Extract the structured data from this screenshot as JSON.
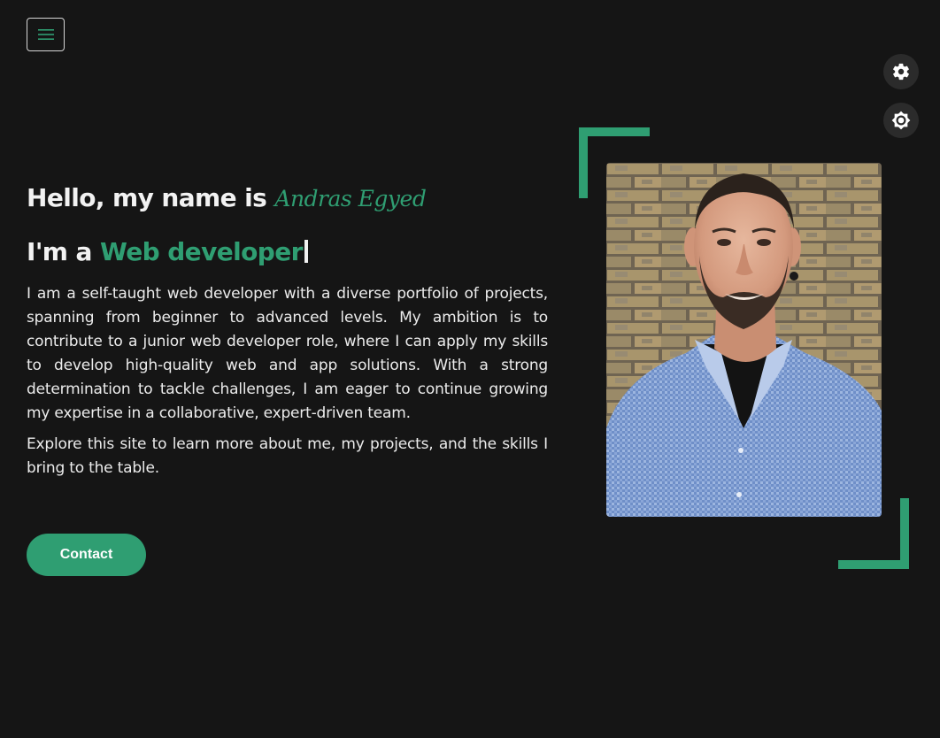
{
  "nav": {
    "menu_icon": "hamburger-icon",
    "settings_icon": "gear-icon",
    "theme_icon": "sun-icon"
  },
  "hero": {
    "greeting_prefix": "Hello, my name is",
    "name": "Andras Egyed",
    "role_prefix": "I'm a",
    "role": "Web developer",
    "about": "I am a self-taught web developer with a diverse portfolio of projects, spanning from beginner to advanced levels. My ambition is to contribute to a junior web developer role, where I can apply my skills to develop high-quality web and app solutions. With a strong determination to tackle challenges, I am eager to continue growing my expertise in a collaborative, expert-driven team.",
    "explore": "Explore this site to learn more about me, my projects, and the skills I bring to the table.",
    "contact_label": "Contact"
  },
  "colors": {
    "background": "#151515",
    "accent": "#2f9e72",
    "text": "#f2f2f2"
  }
}
